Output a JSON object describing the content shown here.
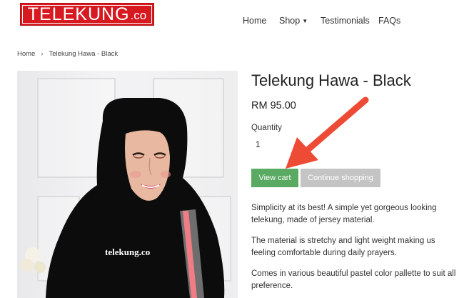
{
  "header": {
    "logo_main": "TELEKUNG",
    "logo_sub": ".co",
    "nav": [
      {
        "label": "Home"
      },
      {
        "label": "Shop"
      },
      {
        "label": "Testimonials"
      },
      {
        "label": "FAQs"
      }
    ]
  },
  "breadcrumb": {
    "home": "Home",
    "separator": "›",
    "current": "Telekung Hawa - Black"
  },
  "product": {
    "image_watermark": "telekung.co",
    "title": "Telekung Hawa - Black",
    "price": "RM 95.00",
    "quantity_label": "Quantity",
    "quantity_value": "1",
    "view_cart_label": "View cart",
    "continue_label": "Continue shopping",
    "description": [
      "Simplicity at its best! A simple yet gorgeous looking telekung, made of jersey material.",
      "The material is stretchy and light weight making us feeling comfortable during daily prayers.",
      "Comes in various beautiful pastel color pallette to suit all preference."
    ]
  },
  "colors": {
    "brand_red": "#d71920",
    "view_cart_green": "#5aaa63",
    "continue_gray": "#c4c4c4",
    "annotation_arrow": "#ee4b36"
  },
  "icons": {
    "shop_dropdown": "caret-down-icon",
    "annotation": "arrow-pointer-icon"
  }
}
